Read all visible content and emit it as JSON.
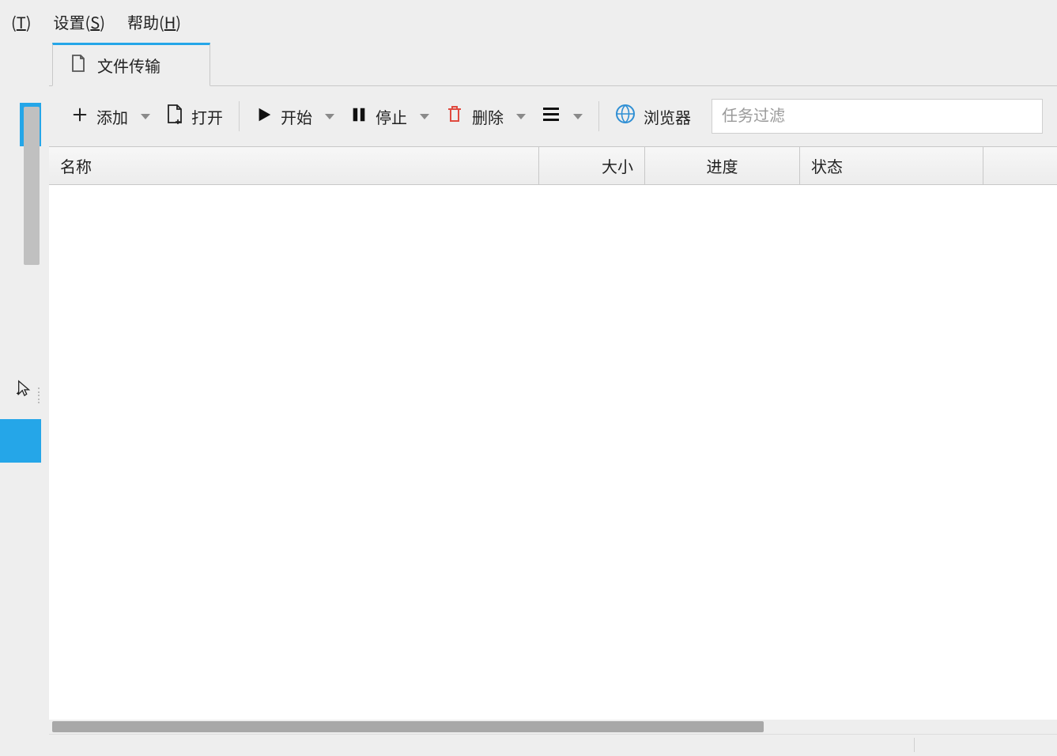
{
  "menu": {
    "tools": {
      "prefix": "(",
      "hotkey": "T",
      "suffix": ")"
    },
    "settings": {
      "label": "设置(",
      "hotkey": "S",
      "suffix": ")"
    },
    "help": {
      "label": "帮助(",
      "hotkey": "H",
      "suffix": ")"
    }
  },
  "tab": {
    "label": "文件传输"
  },
  "toolbar": {
    "add": "添加",
    "open": "打开",
    "start": "开始",
    "stop": "停止",
    "delete": "删除",
    "browser": "浏览器",
    "filter_placeholder": "任务过滤"
  },
  "columns": {
    "name": "名称",
    "size": "大小",
    "progress": "进度",
    "status": "状态"
  }
}
